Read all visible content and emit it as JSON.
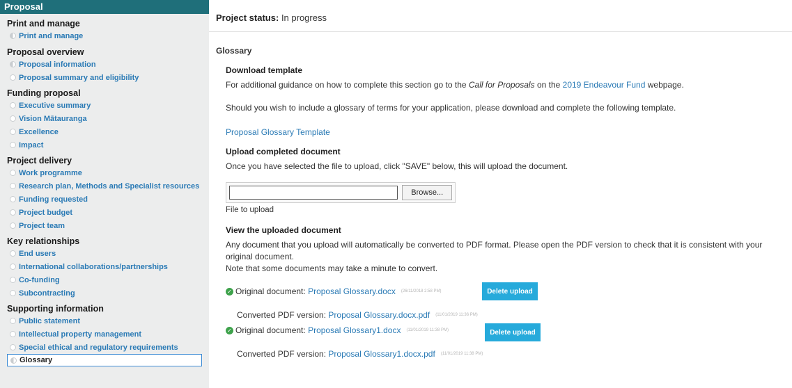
{
  "sidebar": {
    "header": "Proposal",
    "sections": [
      {
        "title": "Print and manage",
        "items": [
          "Print and manage"
        ]
      },
      {
        "title": "Proposal overview",
        "items": [
          "Proposal information",
          "Proposal summary and eligibility"
        ]
      },
      {
        "title": "Funding proposal",
        "items": [
          "Executive summary",
          "Vision Mātauranga",
          "Excellence",
          "Impact"
        ]
      },
      {
        "title": "Project delivery",
        "items": [
          "Work programme",
          "Research plan, Methods and Specialist resources",
          "Funding requested",
          "Project budget",
          "Project team"
        ]
      },
      {
        "title": "Key relationships",
        "items": [
          "End users",
          "International collaborations/partnerships",
          "Co-funding",
          "Subcontracting"
        ]
      },
      {
        "title": "Supporting information",
        "items": [
          "Public statement",
          "Intellectual property management",
          "Special ethical and regulatory requirements",
          "Glossary"
        ]
      }
    ]
  },
  "status": {
    "label": "Project status:",
    "value": "In progress"
  },
  "content": {
    "title": "Glossary",
    "download": {
      "heading": "Download template",
      "guidance_pre": "For additional guidance on how to complete this section go to the ",
      "guidance_em": "Call for Proposals",
      "guidance_mid": " on the ",
      "guidance_link": "2019 Endeavour Fund",
      "guidance_post": " webpage.",
      "wish_text": "Should you wish to include a glossary of terms for your application, please download and complete the following template.",
      "template_link": "Proposal Glossary Template"
    },
    "upload": {
      "heading": "Upload completed document",
      "instructions": "Once you have selected the file to upload, click \"SAVE\" below, this will upload the document.",
      "browse_label": "Browse...",
      "file_label": "File to upload"
    },
    "view": {
      "heading": "View the uploaded document",
      "text1": "Any document that you upload will automatically be converted to PDF format. Please open the PDF version to check that it is consistent with your original document.",
      "text2": "Note that some documents may take a minute to convert.",
      "original_label": "Original document:",
      "converted_label": "Converted PDF version:",
      "delete_label": "Delete upload",
      "docs": [
        {
          "original": "Proposal Glossary.docx",
          "original_ts": "(26/11/2018 2:58 PM)",
          "converted": "Proposal Glossary.docx.pdf",
          "converted_ts": "(11/01/2019 11:36 PM)"
        },
        {
          "original": "Proposal Glossary1.docx",
          "original_ts": "(11/01/2019 11:38 PM)",
          "converted": "Proposal Glossary1.docx.pdf",
          "converted_ts": "(11/01/2019 11:38 PM)"
        }
      ]
    }
  },
  "colors": {
    "header_bg": "#1f6f7a",
    "link": "#2a7ab5",
    "button": "#26aadb",
    "check": "#3ea24b"
  }
}
